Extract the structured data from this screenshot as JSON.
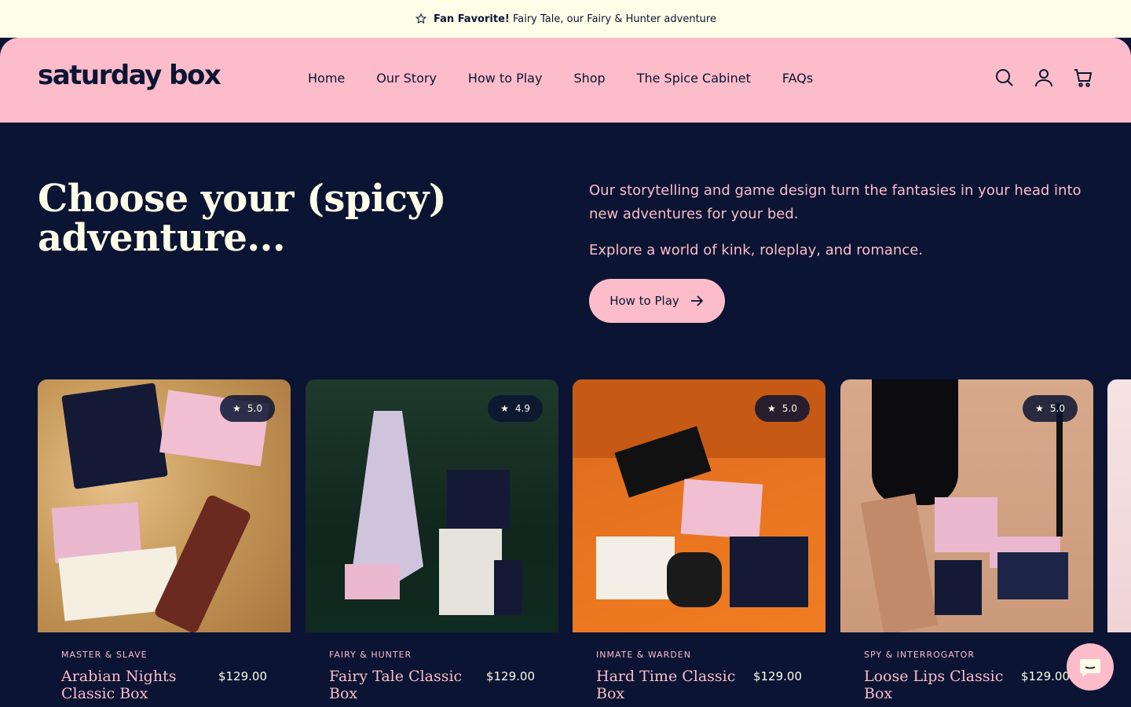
{
  "announcement": {
    "highlight": "Fan Favorite!",
    "text": "Fairy Tale, our Fairy & Hunter adventure"
  },
  "header": {
    "logo": "saturday box",
    "nav": [
      "Home",
      "Our Story",
      "How to Play",
      "Shop",
      "The Spice Cabinet",
      "FAQs"
    ],
    "icons": [
      "search-icon",
      "account-icon",
      "cart-icon"
    ]
  },
  "hero": {
    "title": "Choose your (spicy) adventure...",
    "paragraph1": "Our storytelling and game design turn the fantasies in your head into new adventures for your bed.",
    "paragraph2": "Explore a world of kink, roleplay, and romance.",
    "button": "How to Play"
  },
  "products": [
    {
      "category": "MASTER & SLAVE",
      "name": "Arabian Nights Classic Box",
      "price": "$129.00",
      "rating": "5.0"
    },
    {
      "category": "FAIRY & HUNTER",
      "name": "Fairy Tale Classic Box",
      "price": "$129.00",
      "rating": "4.9"
    },
    {
      "category": "INMATE & WARDEN",
      "name": "Hard Time Classic Box",
      "price": "$129.00",
      "rating": "5.0"
    },
    {
      "category": "SPY & INTERROGATOR",
      "name": "Loose Lips Classic Box",
      "price": "$129.00",
      "rating": "5.0"
    }
  ],
  "colors": {
    "navy": "#0b1433",
    "pink": "#fdbcca",
    "cream": "#fefee8"
  }
}
